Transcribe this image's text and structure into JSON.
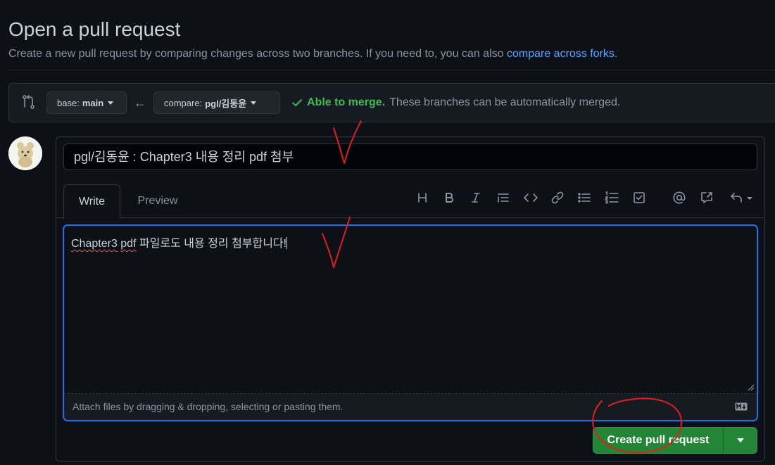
{
  "header": {
    "title": "Open a pull request",
    "subtitle_text": "Create a new pull request by comparing changes across two branches. If you need to, you can also ",
    "subtitle_link": "compare across forks",
    "subtitle_end": "."
  },
  "range": {
    "base_prefix": "base:",
    "base_branch": "main",
    "compare_prefix": "compare:",
    "compare_branch": "pgl/김동윤",
    "merge_ok": "Able to merge.",
    "merge_text": "These branches can be automatically merged."
  },
  "composer": {
    "title_value": "pgl/김동윤 : Chapter3 내용 정리 pdf 첨부",
    "tabs": [
      "Write",
      "Preview"
    ],
    "toolbar_icons": [
      "heading-icon",
      "bold-icon",
      "italic-icon",
      "quote-icon",
      "code-icon",
      "link-icon",
      "bulleted-list-icon",
      "numbered-list-icon",
      "task-list-icon",
      "mention-icon",
      "reference-icon",
      "reply-icon"
    ],
    "body_word1": "Chapter3",
    "body_word2": "pdf",
    "body_rest": " 파일로도 내용 정리 첨부합니다!",
    "attach_hint": "Attach files by dragging & dropping, selecting or pasting them.",
    "submit_label": "Create pull request"
  },
  "colors": {
    "background": "#0d1117",
    "accent_link": "#58a6ff",
    "success": "#3fb950",
    "button_green": "#238636",
    "focus_border": "#1f6feb",
    "annotation_red": "#e11d1d"
  }
}
